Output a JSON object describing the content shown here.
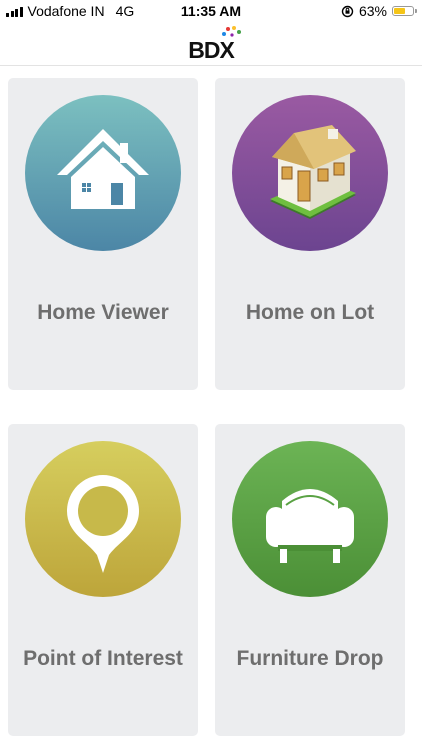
{
  "status_bar": {
    "carrier": "Vodafone IN",
    "network": "4G",
    "time": "11:35 AM",
    "battery_percent": "63%",
    "battery_level": 0.63,
    "battery_color": "#f5c518"
  },
  "header": {
    "logo_text": "BDX"
  },
  "tiles": [
    {
      "label": "Home Viewer",
      "icon": "house-icon",
      "colors": [
        "#7cc0c0",
        "#4c86a6"
      ]
    },
    {
      "label": "Home on Lot",
      "icon": "house-on-lot-icon",
      "colors": [
        "#9a5aa2",
        "#6c4490"
      ]
    },
    {
      "label": "Point of Interest",
      "icon": "map-pin-icon",
      "colors": [
        "#d6ce5e",
        "#bda53a"
      ]
    },
    {
      "label": "Furniture Drop",
      "icon": "armchair-icon",
      "colors": [
        "#6cb455",
        "#4b8f36"
      ]
    }
  ]
}
